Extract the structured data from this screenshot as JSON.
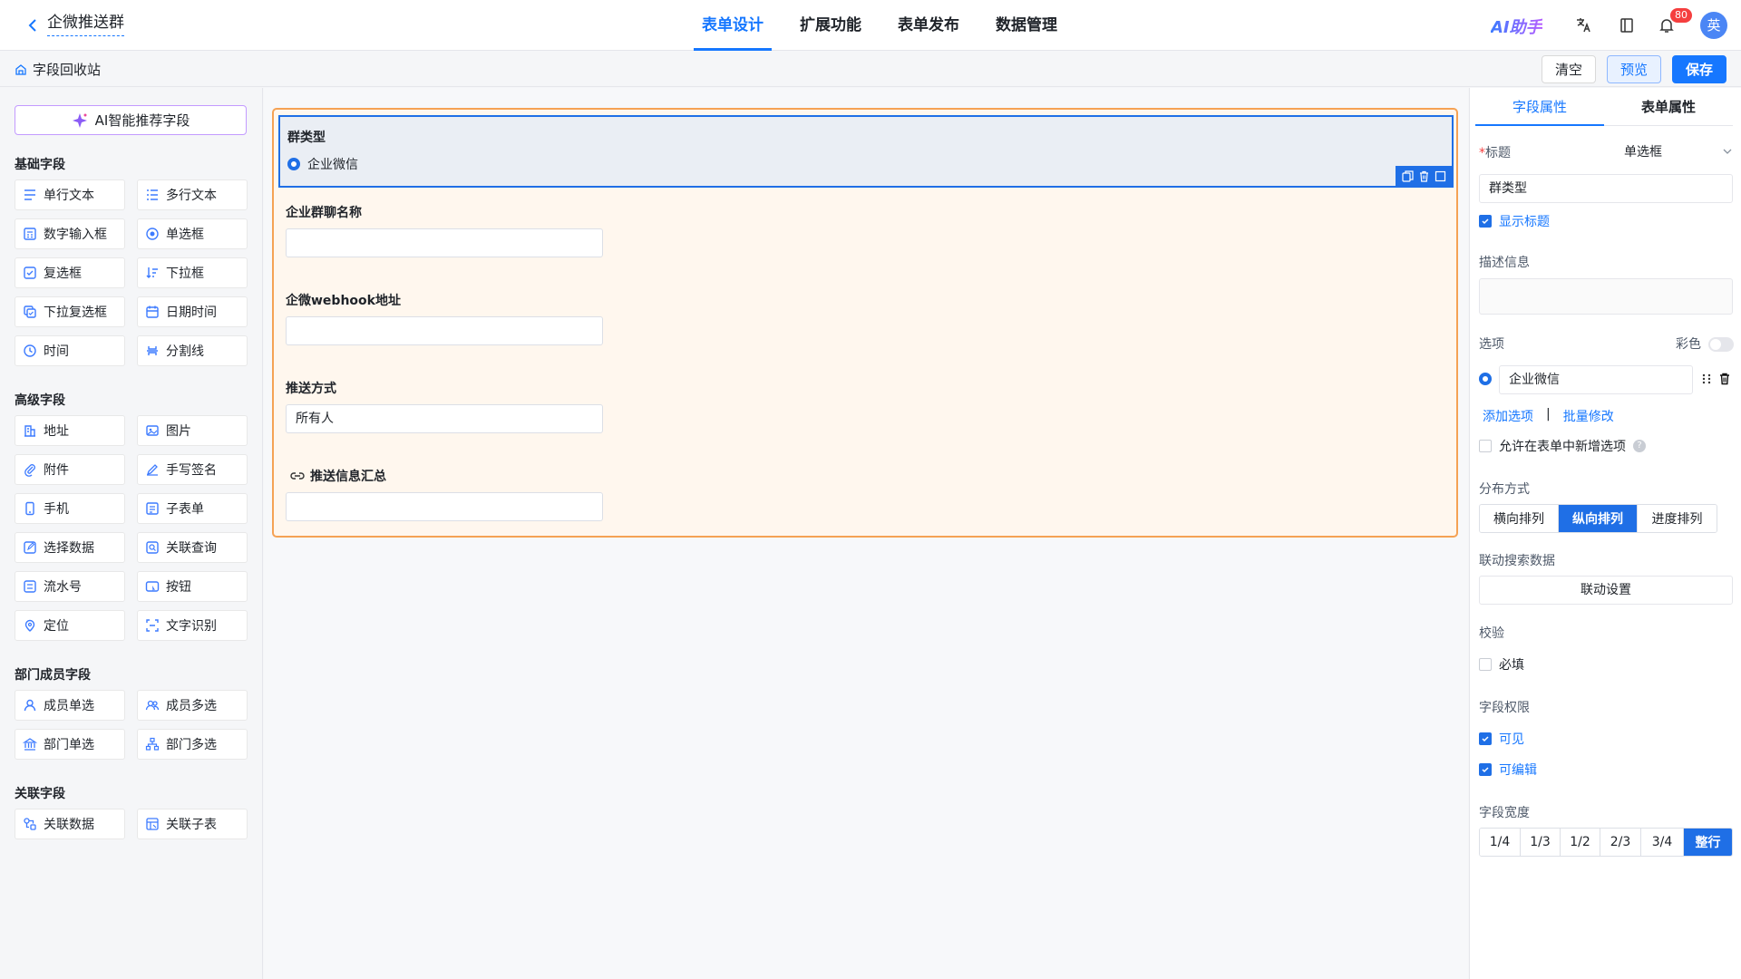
{
  "header": {
    "title": "企微推送群",
    "tabs": [
      {
        "label": "表单设计",
        "active": true
      },
      {
        "label": "扩展功能",
        "active": false
      },
      {
        "label": "表单发布",
        "active": false
      },
      {
        "label": "数据管理",
        "active": false
      }
    ],
    "ai_label": "AI助手",
    "notification_count": "80",
    "avatar_text": "英"
  },
  "toolbar": {
    "recycle_label": "字段回收站",
    "clear_label": "清空",
    "preview_label": "预览",
    "save_label": "保存"
  },
  "left": {
    "ai_button": "AI智能推荐字段",
    "groups": [
      {
        "title": "基础字段",
        "items": [
          "单行文本",
          "多行文本",
          "数字输入框",
          "单选框",
          "复选框",
          "下拉框",
          "下拉复选框",
          "日期时间",
          "时间",
          "分割线"
        ]
      },
      {
        "title": "高级字段",
        "items": [
          "地址",
          "图片",
          "附件",
          "手写签名",
          "手机",
          "子表单",
          "选择数据",
          "关联查询",
          "流水号",
          "按钮",
          "定位",
          "文字识别"
        ]
      },
      {
        "title": "部门成员字段",
        "items": [
          "成员单选",
          "成员多选",
          "部门单选",
          "部门多选"
        ]
      },
      {
        "title": "关联字段",
        "items": [
          "关联数据",
          "关联子表"
        ]
      }
    ]
  },
  "canvas": {
    "fields": {
      "group_type": {
        "label": "群类型",
        "option": "企业微信"
      },
      "group_name": {
        "label": "企业群聊名称",
        "value": ""
      },
      "webhook": {
        "label": "企微webhook地址",
        "value": ""
      },
      "push_mode": {
        "label": "推送方式",
        "value": "所有人"
      },
      "summary": {
        "label": "推送信息汇总",
        "value": ""
      }
    }
  },
  "right": {
    "tabs": [
      {
        "label": "字段属性",
        "active": true
      },
      {
        "label": "表单属性",
        "active": false
      }
    ],
    "title_label": "标题",
    "title_required_mark": "*",
    "field_type": "单选框",
    "title_value": "群类型",
    "show_title_label": "显示标题",
    "desc_label": "描述信息",
    "options_label": "选项",
    "color_label": "彩色",
    "option_value": "企业微信",
    "add_option": "添加选项",
    "separator": "|",
    "batch_edit": "批量修改",
    "allow_new_option": "允许在表单中新增选项",
    "help_mark": "?",
    "layout_label": "分布方式",
    "layout_options": [
      {
        "label": "横向排列",
        "on": false
      },
      {
        "label": "纵向排列",
        "on": true
      },
      {
        "label": "进度排列",
        "on": false
      }
    ],
    "linkage_label": "联动搜索数据",
    "linkage_button": "联动设置",
    "validate_label": "校验",
    "required_label": "必填",
    "permission_label": "字段权限",
    "visible_label": "可见",
    "editable_label": "可编辑",
    "width_label": "字段宽度",
    "widths": [
      {
        "label": "1/4",
        "on": false
      },
      {
        "label": "1/3",
        "on": false
      },
      {
        "label": "1/2",
        "on": false
      },
      {
        "label": "2/3",
        "on": false
      },
      {
        "label": "3/4",
        "on": false
      },
      {
        "label": "整行",
        "on": true
      }
    ]
  },
  "colors": {
    "accent": "#1677ff",
    "form_border": "#f5a254",
    "selected_border": "#1f6fe6"
  }
}
